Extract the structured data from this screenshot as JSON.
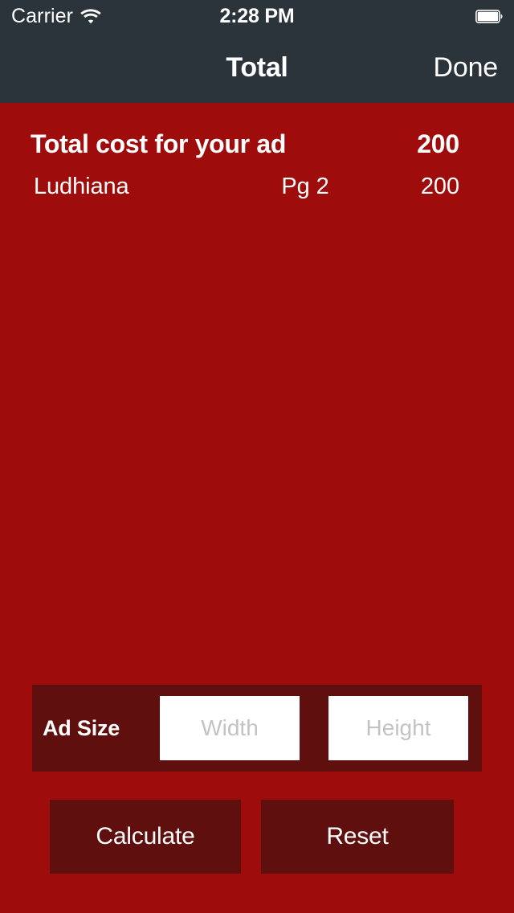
{
  "status_bar": {
    "carrier": "Carrier",
    "wifi_icon": "wifi-icon",
    "time": "2:28 PM",
    "battery_icon": "battery-full-icon"
  },
  "nav_bar": {
    "title": "Total",
    "done_label": "Done"
  },
  "summary": {
    "label": "Total cost for your ad",
    "amount": "200"
  },
  "line_items": [
    {
      "city": "Ludhiana",
      "page": "Pg 2",
      "amount": "200"
    }
  ],
  "ad_size": {
    "label": "Ad Size",
    "width": {
      "value": "",
      "placeholder": "Width"
    },
    "height": {
      "value": "",
      "placeholder": "Height"
    }
  },
  "actions": {
    "calculate_label": "Calculate",
    "reset_label": "Reset"
  },
  "colors": {
    "background": "#9e0c0c",
    "panel": "#5f100e",
    "chrome": "#2b333b",
    "text": "#ffffff",
    "placeholder": "#c3c3c6"
  }
}
